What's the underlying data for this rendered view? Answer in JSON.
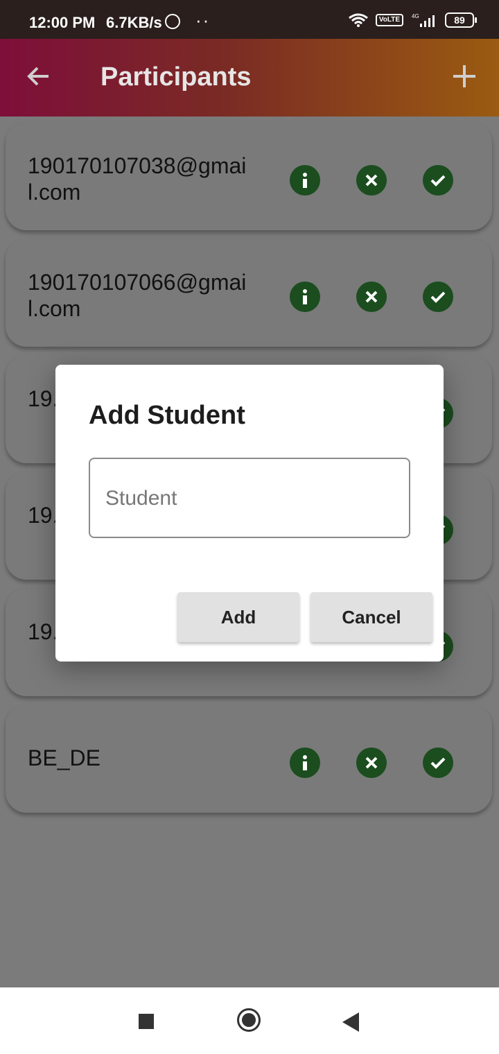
{
  "status_bar": {
    "time": "12:00 PM",
    "net_speed": "6.7KB/s",
    "volte_label": "VoLTE",
    "network_label": "4G",
    "battery_level": "89"
  },
  "app_bar": {
    "title": "Participants"
  },
  "participants": [
    {
      "label": "190170107038@gmail.com"
    },
    {
      "label": "190170107066@gmail.com"
    },
    {
      "label": "19..."
    },
    {
      "label": "19..."
    },
    {
      "label": "19..."
    },
    {
      "label": "BE_DE"
    }
  ],
  "dialog": {
    "title": "Add Student",
    "input_placeholder": "Student",
    "add_label": "Add",
    "cancel_label": "Cancel"
  }
}
